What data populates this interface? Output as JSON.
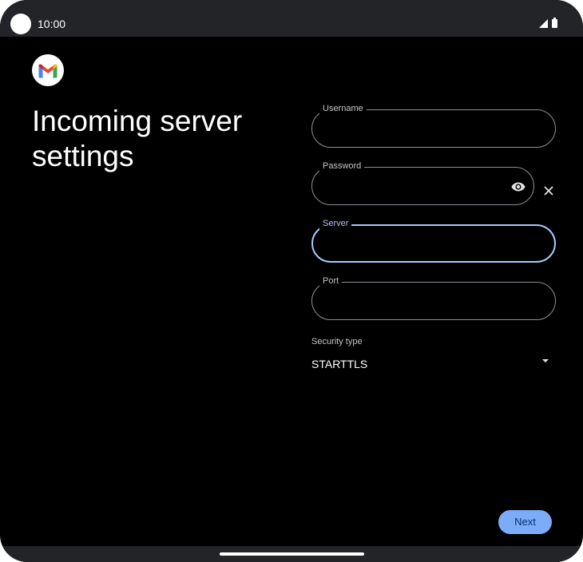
{
  "status_bar": {
    "time": "10:00",
    "icons": [
      "signal-icon",
      "battery-icon"
    ]
  },
  "app": {
    "logo": "gmail-logo",
    "logo_colors": [
      "#4285F4",
      "#EA4335",
      "#FBBC04",
      "#34A853",
      "#C5221F"
    ]
  },
  "page": {
    "title": "Incoming server settings"
  },
  "form": {
    "username": {
      "label": "Username",
      "value": ""
    },
    "password": {
      "label": "Password",
      "value": "",
      "visibility_icon": "eye-icon",
      "clear_icon": "close-icon"
    },
    "server": {
      "label": "Server",
      "value": "",
      "focused": true
    },
    "port": {
      "label": "Port",
      "value": ""
    },
    "security": {
      "label": "Security type",
      "value": "STARTTLS",
      "icon": "dropdown-arrow-icon"
    }
  },
  "actions": {
    "next_label": "Next"
  },
  "colors": {
    "background": "#000000",
    "bars": "#232427",
    "accent": "#a8c7fa",
    "button": "#7cacf8",
    "field_border": "#8e9099"
  }
}
